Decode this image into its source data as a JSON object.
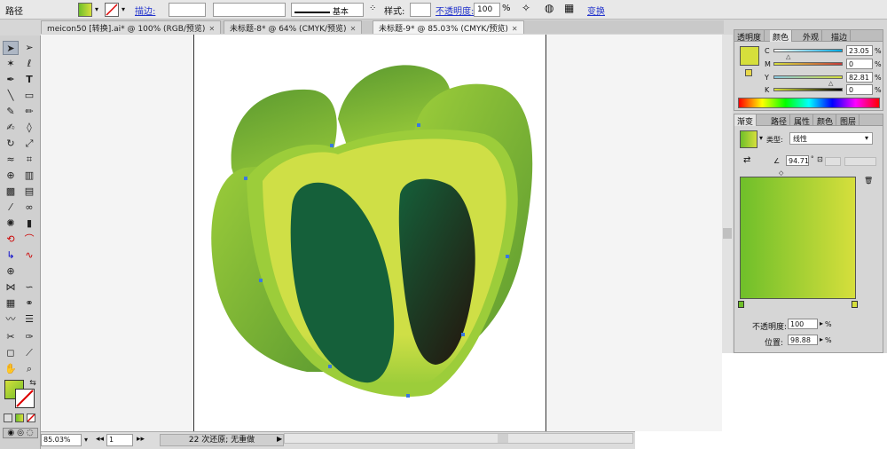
{
  "control_bar": {
    "object_type": "路径",
    "stroke_label": "描边:",
    "stroke_profile": "基本",
    "style_label": "样式:",
    "opacity_label": "不透明度:",
    "opacity_value": "100",
    "opacity_unit": "%",
    "transform_label": "变换"
  },
  "tabs": [
    {
      "label": "meicon50 [转换].ai* @ 100% (RGB/预览)"
    },
    {
      "label": "未标题-8* @ 64% (CMYK/预览)"
    },
    {
      "label": "未标题-9* @ 85.03% (CMYK/预览)"
    }
  ],
  "status": {
    "zoom": "85.03%",
    "page": "1",
    "undo_text": "22 次还原; 无重做"
  },
  "color_panel": {
    "tabs": [
      "透明度",
      "颜色",
      "外观",
      "描边"
    ],
    "channels": [
      {
        "label": "C",
        "value": "23.05"
      },
      {
        "label": "M",
        "value": "0"
      },
      {
        "label": "Y",
        "value": "82.81"
      },
      {
        "label": "K",
        "value": "0"
      }
    ]
  },
  "gradient_panel": {
    "tabs": [
      "渐变",
      "路径",
      "属性",
      "颜色",
      "图层"
    ],
    "type_label": "类型:",
    "type_value": "线性",
    "angle_value": "94.71",
    "opacity_label": "不透明度:",
    "opacity_value": "100",
    "opacity_unit": "%",
    "location_label": "位置:",
    "location_value": "98.88",
    "location_unit": "%",
    "start_color": "#6fbf2a",
    "end_color": "#d6df3c"
  },
  "artwork": {
    "outer_dark": "#5c9a30",
    "outer_light": "#9ccd3a",
    "slice_fill": "#cfdf46",
    "slice_rim": "#9ccd3a",
    "seed_dark": "#15603a",
    "seed_deep": "#231a10"
  }
}
